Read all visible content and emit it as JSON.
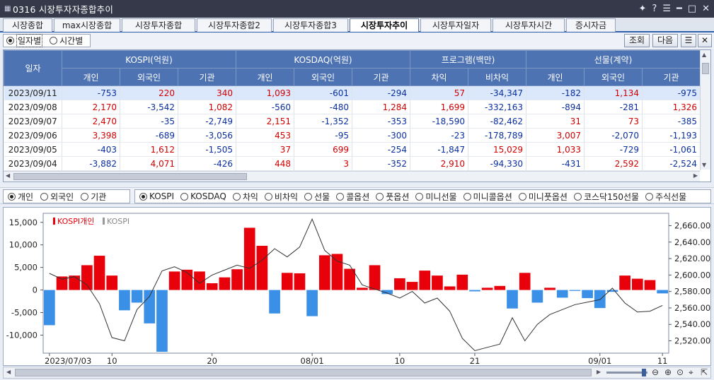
{
  "window": {
    "title": "0316 시장투자자종합추이"
  },
  "tabs": [
    {
      "label": "시장종합",
      "active": false
    },
    {
      "label": "max시장종합",
      "active": false
    },
    {
      "label": "시장투자종합",
      "active": false
    },
    {
      "label": "시장투자종합2",
      "active": false
    },
    {
      "label": "시장투자종합3",
      "active": false
    },
    {
      "label": "시장투자추이",
      "active": true
    },
    {
      "label": "시장투자일자",
      "active": false
    },
    {
      "label": "시장투자시간",
      "active": false
    },
    {
      "label": "증시자금",
      "active": false
    }
  ],
  "options": {
    "daily_label": "일자별",
    "time_label": "시간별",
    "inquiry_label": "조회",
    "next_label": "다음"
  },
  "table": {
    "date_header": "일자",
    "groups": [
      "KOSPI(억원)",
      "KOSDAQ(억원)",
      "프로그램(백만)",
      "선물(계약)"
    ],
    "subheaders": [
      "개인",
      "외국인",
      "기관",
      "개인",
      "외국인",
      "기관",
      "차익",
      "비차익",
      "개인",
      "외국인",
      "기관"
    ],
    "rows": [
      {
        "date": "2023/09/11",
        "cells": [
          "-753",
          "220",
          "340",
          "1,093",
          "-601",
          "-294",
          "57",
          "-34,347",
          "-182",
          "1,134",
          "-975"
        ]
      },
      {
        "date": "2023/09/08",
        "cells": [
          "2,170",
          "-3,542",
          "1,082",
          "-560",
          "-480",
          "1,284",
          "1,699",
          "-332,163",
          "-894",
          "-281",
          "1,326"
        ]
      },
      {
        "date": "2023/09/07",
        "cells": [
          "2,470",
          "-35",
          "-2,749",
          "2,151",
          "-1,352",
          "-353",
          "-18,590",
          "-82,462",
          "31",
          "73",
          "-385"
        ]
      },
      {
        "date": "2023/09/06",
        "cells": [
          "3,398",
          "-689",
          "-3,056",
          "453",
          "-95",
          "-300",
          "-23",
          "-178,789",
          "3,007",
          "-2,070",
          "-1,193"
        ]
      },
      {
        "date": "2023/09/05",
        "cells": [
          "-403",
          "1,612",
          "-1,505",
          "37",
          "699",
          "-254",
          "-1,847",
          "15,029",
          "1,033",
          "-729",
          "-1,061"
        ]
      },
      {
        "date": "2023/09/04",
        "cells": [
          "-3,882",
          "4,071",
          "-426",
          "448",
          "3",
          "-352",
          "2,910",
          "-94,330",
          "-431",
          "2,592",
          "-2,524"
        ]
      }
    ]
  },
  "filters": {
    "investors": [
      {
        "label": "개인",
        "selected": true
      },
      {
        "label": "외국인",
        "selected": false
      },
      {
        "label": "기관",
        "selected": false
      }
    ],
    "markets": [
      {
        "label": "KOSPI",
        "selected": true
      },
      {
        "label": "KOSDAQ",
        "selected": false
      },
      {
        "label": "차익",
        "selected": false
      },
      {
        "label": "비차익",
        "selected": false
      },
      {
        "label": "선물",
        "selected": false
      },
      {
        "label": "콜옵션",
        "selected": false
      },
      {
        "label": "풋옵션",
        "selected": false
      },
      {
        "label": "미니선물",
        "selected": false
      },
      {
        "label": "미니콜옵션",
        "selected": false
      },
      {
        "label": "미니풋옵션",
        "selected": false
      },
      {
        "label": "코스닥150선물",
        "selected": false
      },
      {
        "label": "주식선물",
        "selected": false
      }
    ]
  },
  "colors": {
    "positive": "#d10000",
    "negative": "#0a2f9f",
    "bar_up": "#e8000b",
    "bar_down": "#3a8fe6",
    "header": "#4e73b3"
  },
  "chart_data": {
    "type": "bar",
    "legend": [
      "KOSPI개인",
      "KOSPI"
    ],
    "legend_placement": "top-left",
    "y_left_ticks": [
      "15,000",
      "10,000",
      "5,000",
      "0",
      "-5,000",
      "-10,000"
    ],
    "y_right_ticks": [
      "2,660.00",
      "2,640.00",
      "2,620.00",
      "2,600.00",
      "2,580.00",
      "2,560.00",
      "2,540.00",
      "2,520.00"
    ],
    "ylim_left": [
      -14000,
      17000
    ],
    "ylim_right": [
      2505,
      2675
    ],
    "x_labels": [
      {
        "label": "2023/07/03",
        "index": 0
      },
      {
        "label": "10",
        "index": 5
      },
      {
        "label": "20",
        "index": 13
      },
      {
        "label": "08/01",
        "index": 21
      },
      {
        "label": "10",
        "index": 28
      },
      {
        "label": "21",
        "index": 34
      },
      {
        "label": "09/01",
        "index": 44
      },
      {
        "label": "11",
        "index": 49
      }
    ],
    "series": [
      {
        "name": "KOSPI개인",
        "axis": "left",
        "values": [
          -7800,
          3000,
          3200,
          5500,
          7600,
          3200,
          -4500,
          -2800,
          -7400,
          -13700,
          4100,
          4500,
          4100,
          1500,
          2800,
          4600,
          13800,
          9800,
          -5200,
          3800,
          3700,
          -5800,
          7700,
          8000,
          4700,
          500,
          5500,
          -900,
          2600,
          1800,
          4300,
          3200,
          800,
          3400,
          -300,
          500,
          900,
          -4100,
          3800,
          -2800,
          500,
          -1700,
          -200,
          -1800,
          -4000,
          -400,
          3200,
          2500,
          2200,
          -750
        ]
      },
      {
        "name": "KOSPI",
        "axis": "right",
        "values": [
          2602,
          2595,
          2598,
          2588,
          2565,
          2524,
          2520,
          2558,
          2574,
          2605,
          2610,
          2603,
          2590,
          2600,
          2606,
          2612,
          2608,
          2618,
          2632,
          2622,
          2634,
          2668,
          2630,
          2617,
          2612,
          2588,
          2583,
          2578,
          2572,
          2580,
          2566,
          2572,
          2556,
          2523,
          2508,
          2512,
          2516,
          2548,
          2520,
          2540,
          2552,
          2558,
          2564,
          2567,
          2570,
          2584,
          2566,
          2555,
          2556,
          2563
        ]
      }
    ]
  }
}
